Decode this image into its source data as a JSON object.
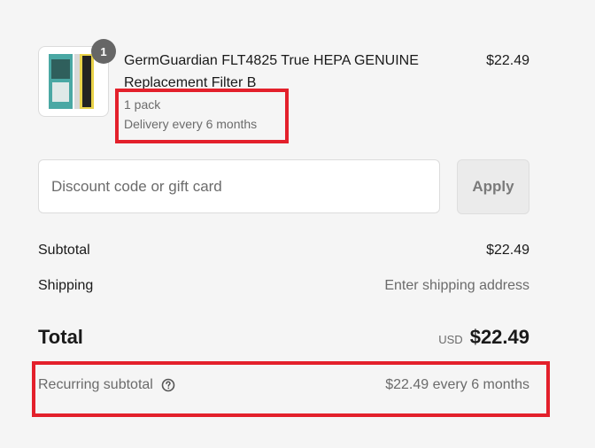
{
  "line_item": {
    "quantity": "1",
    "title": "GermGuardian FLT4825 True HEPA GENUINE Replacement Filter B",
    "price": "$22.49",
    "variant": "1 pack",
    "delivery": "Delivery every 6 months",
    "thumbnail_icon": "product-image-icon"
  },
  "discount": {
    "placeholder": "Discount code or gift card",
    "value": "",
    "apply_label": "Apply"
  },
  "summary": {
    "subtotal_label": "Subtotal",
    "subtotal_value": "$22.49",
    "shipping_label": "Shipping",
    "shipping_value": "Enter shipping address",
    "total_label": "Total",
    "currency": "USD",
    "total_value": "$22.49",
    "recurring_label": "Recurring subtotal",
    "recurring_value": "$22.49 every 6 months",
    "help_icon": "question-circle-icon"
  },
  "colors": {
    "highlight": "#e3202b",
    "background": "#f5f5f5",
    "text": "#1a1a1a",
    "muted_text": "#6b6b6b"
  }
}
